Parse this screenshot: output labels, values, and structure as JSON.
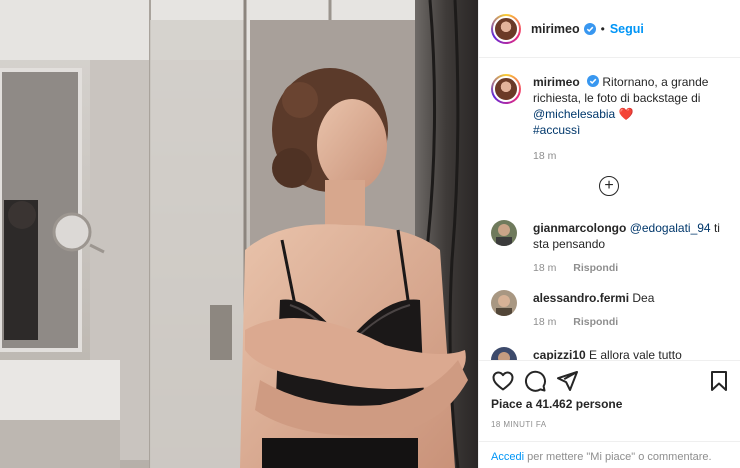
{
  "post": {
    "username": "mirimeo",
    "follow_label": "Segui",
    "dot": "•"
  },
  "caption": {
    "username": "mirimeo",
    "text_1": "Ritornano, a grande richiesta, le foto di backstage di",
    "mention": "@michelesabia",
    "heart": "❤️",
    "hashtag": "#accussì",
    "time": "18 m"
  },
  "comments": [
    {
      "username": "gianmarcolongo",
      "mention": "@edogalati_94",
      "text": "ti sta pensando",
      "time": "18 m",
      "reply_label": "Rispondi"
    },
    {
      "username": "alessandro.fermi",
      "mention": "",
      "text": "Dea",
      "time": "18 m",
      "reply_label": "Rispondi"
    },
    {
      "username": "capizzi10",
      "mention": "",
      "text": "E allora vale tutto",
      "time": "",
      "reply_label": ""
    }
  ],
  "load_more_symbol": "+",
  "actions": {
    "likes": "Piace a 41.462 persone",
    "timestamp": "18 MINUTI FA",
    "login_link": "Accedi",
    "login_rest": "per mettere \"Mi piace\" o commentare."
  },
  "icons": [
    "verified-badge-icon",
    "heart-outline-icon",
    "comment-icon",
    "share-icon",
    "bookmark-icon",
    "plus-circle-icon"
  ],
  "colors": {
    "accent": "#0095f6",
    "link": "#00376b",
    "muted": "#8e8e8e",
    "text": "#262626",
    "heart": "#ed4956"
  }
}
